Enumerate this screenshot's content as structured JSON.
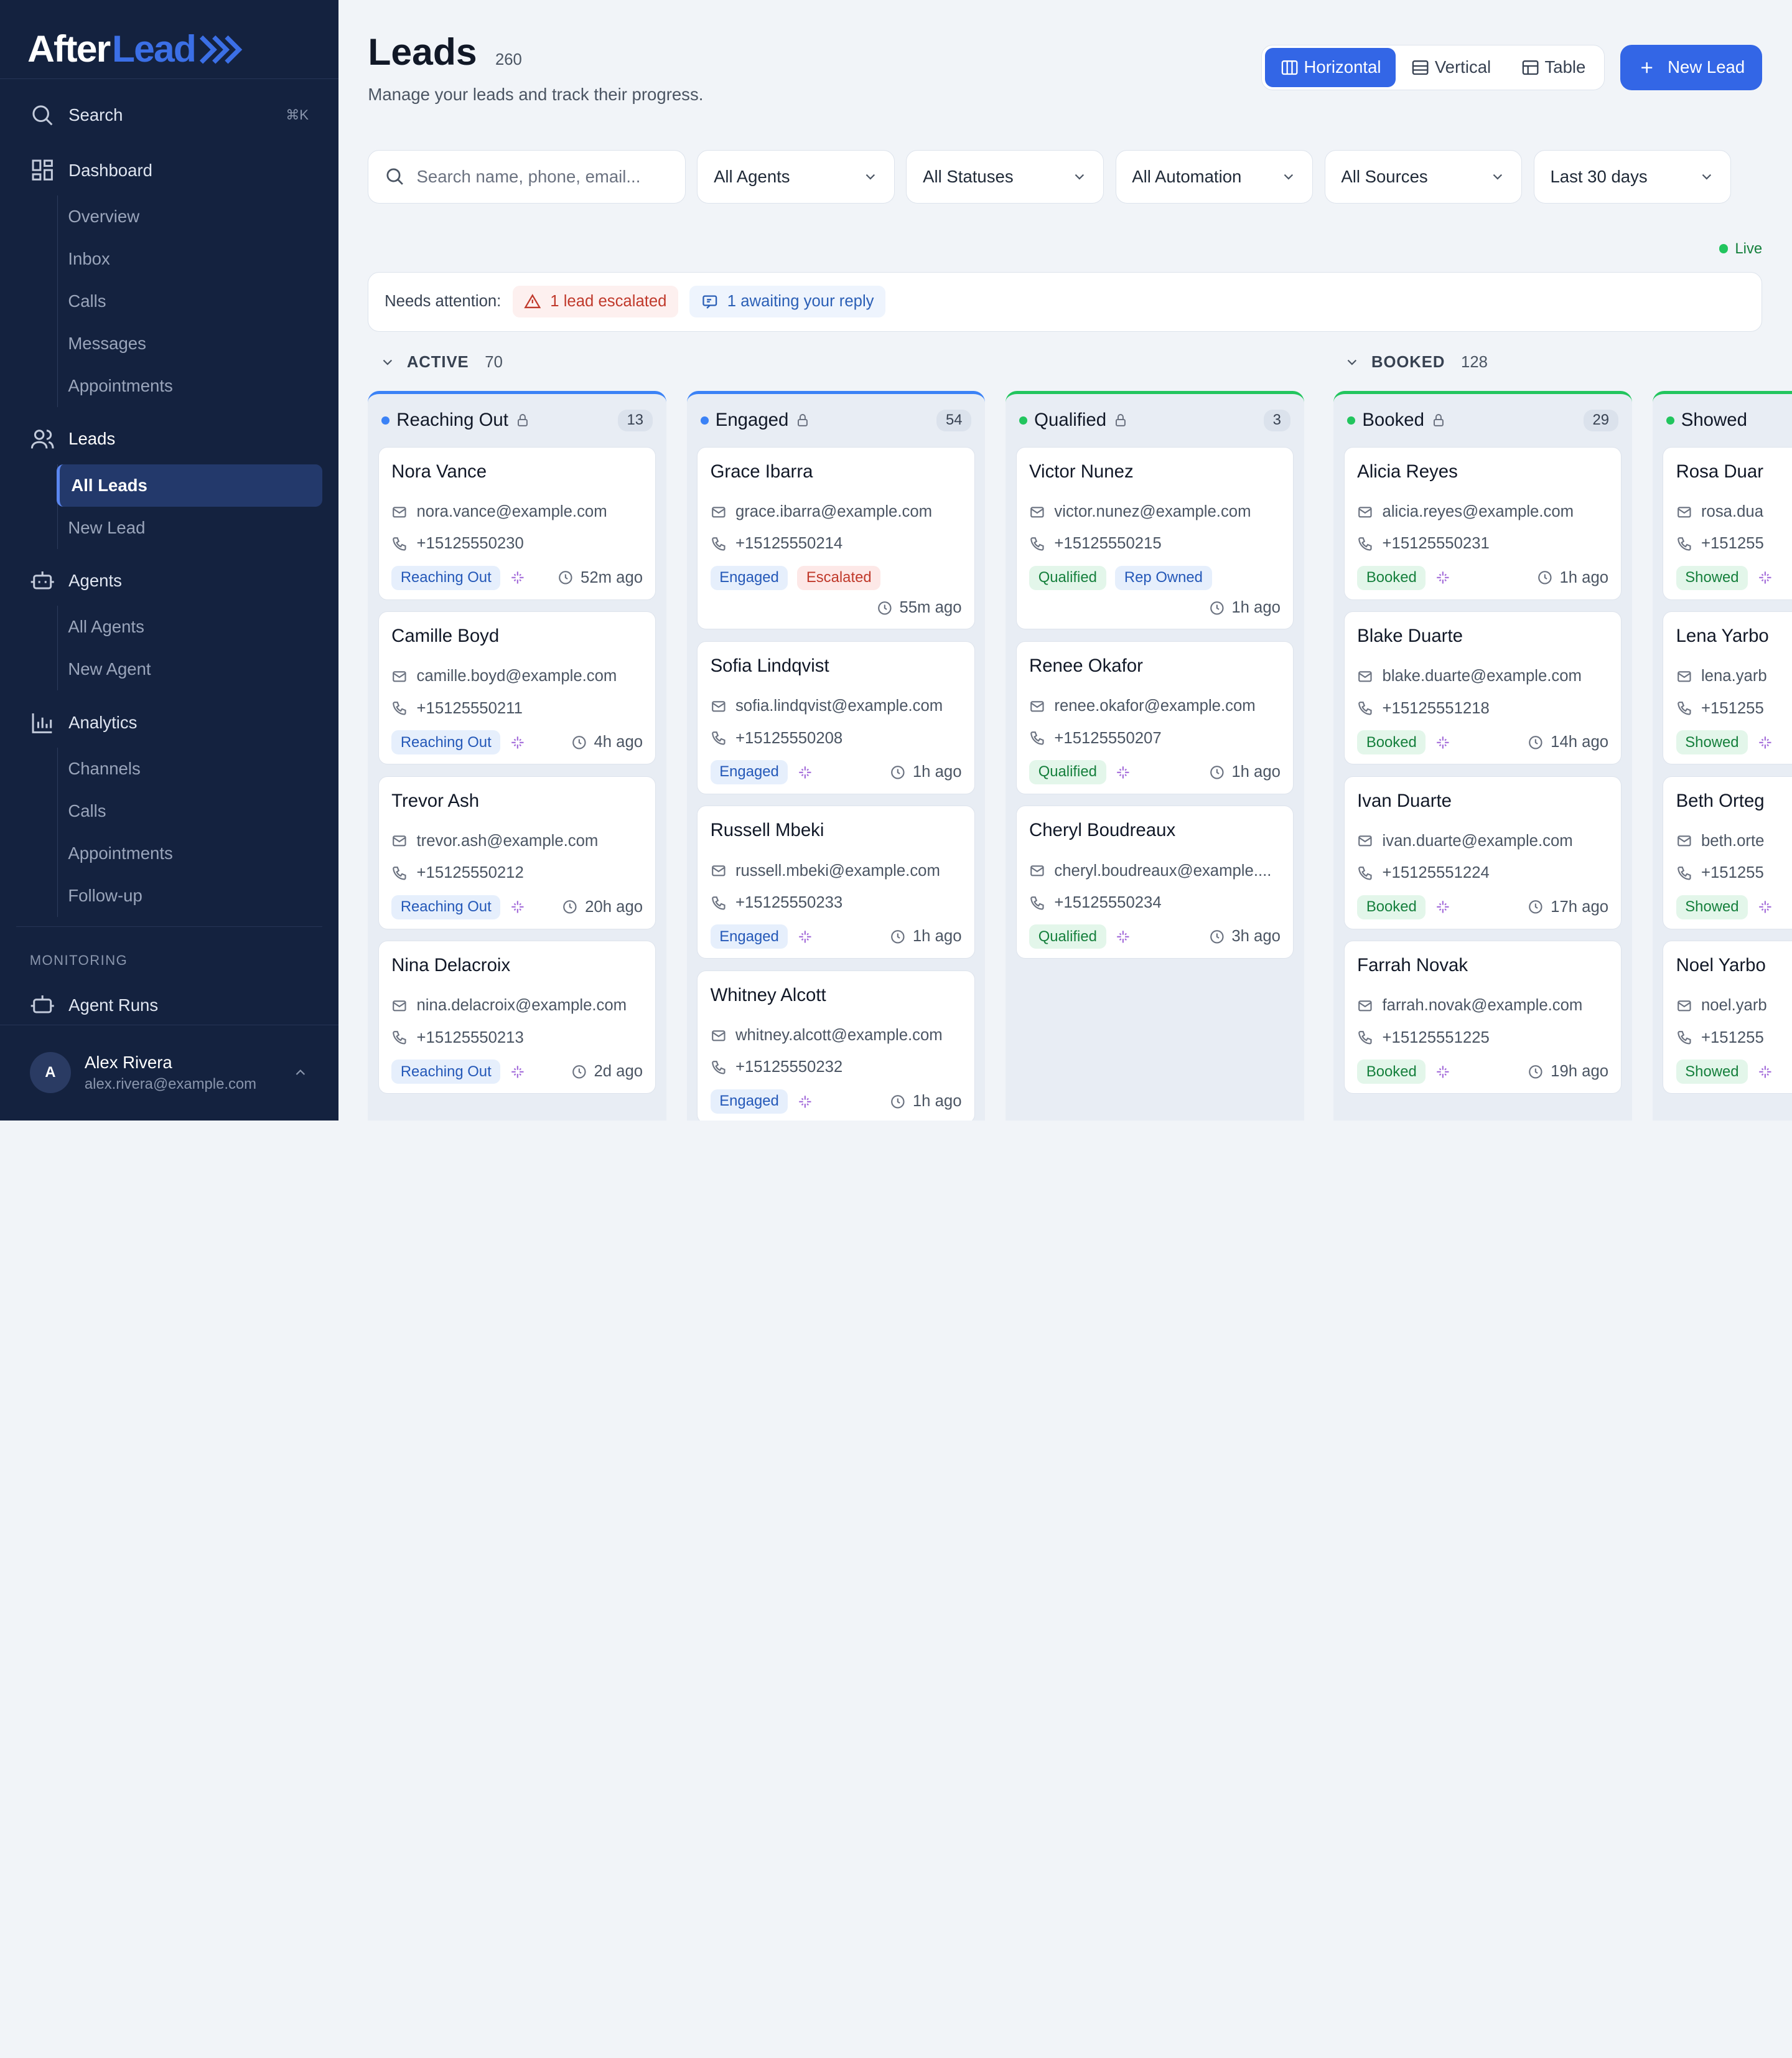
{
  "brand": {
    "name_a": "After",
    "name_b": "Lead"
  },
  "sidebar": {
    "search_label": "Search",
    "search_kbd": "⌘K",
    "dashboard": "Dashboard",
    "dashboard_sub": [
      "Overview",
      "Inbox",
      "Calls",
      "Messages",
      "Appointments"
    ],
    "leads": "Leads",
    "leads_sub": [
      "All Leads",
      "New Lead"
    ],
    "agents": "Agents",
    "agents_sub": [
      "All Agents",
      "New Agent"
    ],
    "analytics": "Analytics",
    "analytics_sub": [
      "Channels",
      "Calls",
      "Appointments",
      "Follow-up"
    ],
    "monitoring_label": "MONITORING",
    "agent_runs": "Agent Runs",
    "user": {
      "initial": "A",
      "name": "Alex Rivera",
      "email": "alex.rivera@example.com"
    }
  },
  "header": {
    "title": "Leads",
    "count": "260",
    "subtitle": "Manage your leads and track their progress.",
    "views": [
      "Horizontal",
      "Vertical",
      "Table"
    ],
    "new_lead": "New Lead"
  },
  "filters": {
    "search_placeholder": "Search name, phone, email...",
    "selects": [
      "All Agents",
      "All Statuses",
      "All Automation",
      "All Sources",
      "Last 30 days"
    ]
  },
  "live": "Live",
  "attention": {
    "label": "Needs attention:",
    "escalated": "1 lead escalated",
    "awaiting": "1 awaiting your reply"
  },
  "groups": [
    {
      "name": "ACTIVE",
      "count": "70"
    },
    {
      "name": "BOOKED",
      "count": "128"
    }
  ],
  "columns": [
    {
      "name": "Reaching Out",
      "count": "13",
      "cards": [
        {
          "name": "Nora Vance",
          "email": "nora.vance@example.com",
          "phone": "+15125550230",
          "status": "Reaching Out",
          "time": "52m ago"
        },
        {
          "name": "Camille Boyd",
          "email": "camille.boyd@example.com",
          "phone": "+15125550211",
          "status": "Reaching Out",
          "time": "4h ago"
        },
        {
          "name": "Trevor Ash",
          "email": "trevor.ash@example.com",
          "phone": "+15125550212",
          "status": "Reaching Out",
          "time": "20h ago"
        },
        {
          "name": "Nina Delacroix",
          "email": "nina.delacroix@example.com",
          "phone": "+15125550213",
          "status": "Reaching Out",
          "time": "2d ago"
        }
      ]
    },
    {
      "name": "Engaged",
      "count": "54",
      "cards": [
        {
          "name": "Grace Ibarra",
          "email": "grace.ibarra@example.com",
          "phone": "+15125550214",
          "status": "Engaged",
          "extra": "Escalated",
          "time": "55m ago"
        },
        {
          "name": "Sofia Lindqvist",
          "email": "sofia.lindqvist@example.com",
          "phone": "+15125550208",
          "status": "Engaged",
          "time": "1h ago"
        },
        {
          "name": "Russell Mbeki",
          "email": "russell.mbeki@example.com",
          "phone": "+15125550233",
          "status": "Engaged",
          "time": "1h ago"
        },
        {
          "name": "Whitney Alcott",
          "email": "whitney.alcott@example.com",
          "phone": "+15125550232",
          "status": "Engaged",
          "time": "1h ago"
        }
      ]
    },
    {
      "name": "Qualified",
      "count": "3",
      "cards": [
        {
          "name": "Victor Nunez",
          "email": "victor.nunez@example.com",
          "phone": "+15125550215",
          "status": "Qualified",
          "extra": "Rep Owned",
          "time": "1h ago"
        },
        {
          "name": "Renee Okafor",
          "email": "renee.okafor@example.com",
          "phone": "+15125550207",
          "status": "Qualified",
          "time": "1h ago"
        },
        {
          "name": "Cheryl Boudreaux",
          "email": "cheryl.boudreaux@example....",
          "phone": "+15125550234",
          "status": "Qualified",
          "time": "3h ago"
        }
      ]
    },
    {
      "name": "Booked",
      "count": "29",
      "cards": [
        {
          "name": "Alicia Reyes",
          "email": "alicia.reyes@example.com",
          "phone": "+15125550231",
          "status": "Booked",
          "time": "1h ago"
        },
        {
          "name": "Blake Duarte",
          "email": "blake.duarte@example.com",
          "phone": "+15125551218",
          "status": "Booked",
          "time": "14h ago"
        },
        {
          "name": "Ivan Duarte",
          "email": "ivan.duarte@example.com",
          "phone": "+15125551224",
          "status": "Booked",
          "time": "17h ago"
        },
        {
          "name": "Farrah Novak",
          "email": "farrah.novak@example.com",
          "phone": "+15125551225",
          "status": "Booked",
          "time": "19h ago"
        }
      ]
    },
    {
      "name": "Showed",
      "count": "",
      "cards": [
        {
          "name": "Rosa Duar",
          "email": "rosa.dua",
          "phone": "+151255",
          "status": "Showed",
          "time": ""
        },
        {
          "name": "Lena Yarbo",
          "email": "lena.yarb",
          "phone": "+151255",
          "status": "Showed",
          "time": ""
        },
        {
          "name": "Beth Orteg",
          "email": "beth.orte",
          "phone": "+151255",
          "status": "Showed",
          "time": ""
        },
        {
          "name": "Noel Yarbo",
          "email": "noel.yarb",
          "phone": "+151255",
          "status": "Showed",
          "time": ""
        }
      ]
    }
  ],
  "colors": {
    "accent": "#3366e6",
    "sidebar": "#14223f",
    "blue": "#3b82f6",
    "green": "#22c55e",
    "red": "#c0392b"
  }
}
